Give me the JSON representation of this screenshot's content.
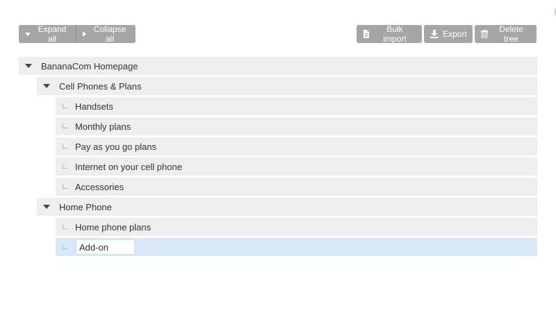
{
  "toolbar": {
    "expand_all": "Expand all",
    "collapse_all": "Collapse all",
    "bulk_import": "Bulk import",
    "export": "Export",
    "delete_tree": "Delete tree"
  },
  "tree": {
    "root": {
      "label": "BananaCom Homepage",
      "children": [
        {
          "label": "Cell Phones & Plans",
          "children": [
            {
              "label": "Handsets"
            },
            {
              "label": "Monthly plans"
            },
            {
              "label": "Pay as you go plans"
            },
            {
              "label": "Internet on your cell phone"
            },
            {
              "label": "Accessories"
            }
          ]
        },
        {
          "label": "Home Phone",
          "children": [
            {
              "label": "Home phone plans"
            },
            {
              "label": "Add-on",
              "editing": true
            }
          ]
        }
      ]
    }
  },
  "colors": {
    "button_bg": "#a6a6a6",
    "node_bg": "#eeeeee",
    "selected_bg": "#d9e8f8"
  },
  "icons": {
    "expand": "caret-down-icon",
    "collapse": "caret-right-icon",
    "bulk_import": "document-icon",
    "export": "download-icon",
    "delete": "trash-icon",
    "leaf": "leaf-connector-icon"
  }
}
